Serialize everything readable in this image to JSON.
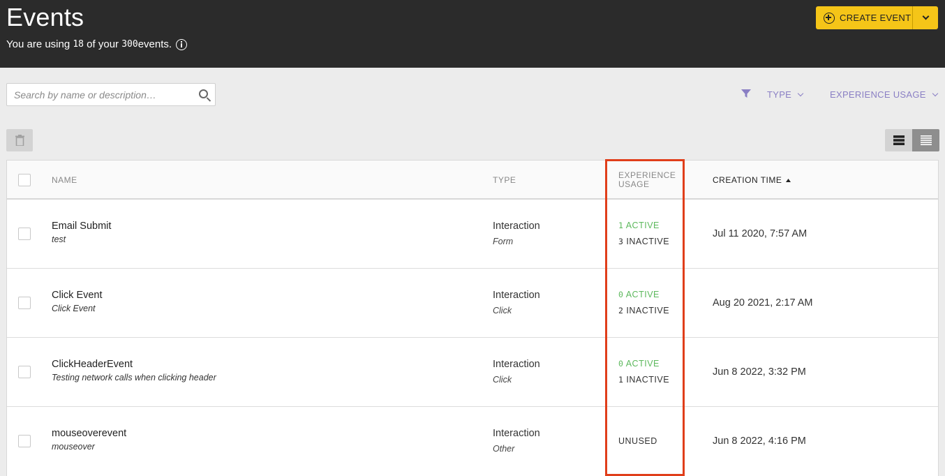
{
  "header": {
    "title": "Events",
    "usage_prefix": "You are using ",
    "usage_used": "18",
    "usage_mid": " of your ",
    "usage_total": "300",
    "usage_suffix": " events.",
    "create_button": "CREATE EVENT"
  },
  "toolbar": {
    "search_placeholder": "Search by name or description…",
    "filter_type": "TYPE",
    "filter_experience_usage": "EXPERIENCE USAGE"
  },
  "table": {
    "columns": {
      "name": "NAME",
      "type": "TYPE",
      "experience_usage_line1": "EXPERIENCE",
      "experience_usage_line2": "USAGE",
      "creation_time": "CREATION TIME"
    },
    "rows": [
      {
        "name": "Email Submit",
        "description": "test",
        "type": "Interaction",
        "subtype": "Form",
        "active_count": "1",
        "active_label": " ACTIVE",
        "inactive_count": "3",
        "inactive_label": " INACTIVE",
        "created": "Jul 11 2020, 7:57 AM"
      },
      {
        "name": "Click Event",
        "description": "Click Event",
        "type": "Interaction",
        "subtype": "Click",
        "active_count": "0",
        "active_label": " ACTIVE",
        "inactive_count": "2",
        "inactive_label": " INACTIVE",
        "created": "Aug 20 2021, 2:17 AM"
      },
      {
        "name": "ClickHeaderEvent",
        "description": "Testing network calls when clicking header",
        "type": "Interaction",
        "subtype": "Click",
        "active_count": "0",
        "active_label": " ACTIVE",
        "inactive_count": "1",
        "inactive_label": " INACTIVE",
        "created": "Jun 8 2022, 3:32 PM"
      },
      {
        "name": "mouseoverevent",
        "description": "mouseover",
        "type": "Interaction",
        "subtype": "Other",
        "usage": "UNUSED",
        "created": "Jun 8 2022, 4:16 PM"
      }
    ]
  },
  "colors": {
    "header_bg": "#2b2b2b",
    "accent_yellow": "#f5c518",
    "filter_purple": "#8a7fc4",
    "active_green": "#5cb85c",
    "highlight_red": "#e03e1a"
  }
}
